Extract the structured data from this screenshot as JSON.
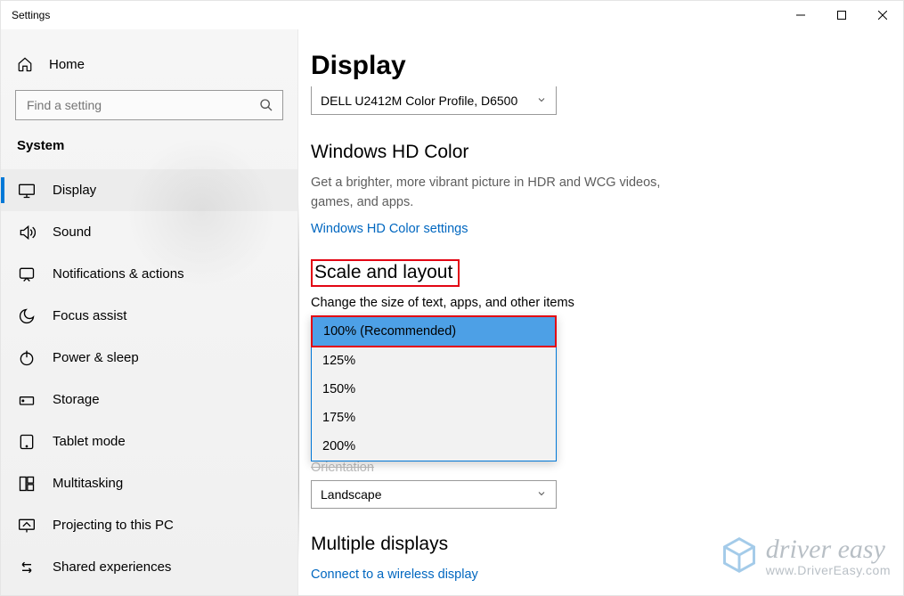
{
  "titlebar": {
    "title": "Settings"
  },
  "sidebar": {
    "home_label": "Home",
    "search_placeholder": "Find a setting",
    "category": "System",
    "items": [
      {
        "label": "Display"
      },
      {
        "label": "Sound"
      },
      {
        "label": "Notifications & actions"
      },
      {
        "label": "Focus assist"
      },
      {
        "label": "Power & sleep"
      },
      {
        "label": "Storage"
      },
      {
        "label": "Tablet mode"
      },
      {
        "label": "Multitasking"
      },
      {
        "label": "Projecting to this PC"
      },
      {
        "label": "Shared experiences"
      }
    ]
  },
  "main": {
    "page_title": "Display",
    "color_profile_selected": "DELL U2412M Color Profile, D6500",
    "hd_color": {
      "title": "Windows HD Color",
      "desc": "Get a brighter, more vibrant picture in HDR and WCG videos, games, and apps.",
      "link": "Windows HD Color settings"
    },
    "scale": {
      "title": "Scale and layout",
      "change_label": "Change the size of text, apps, and other items",
      "options": [
        "100% (Recommended)",
        "125%",
        "150%",
        "175%",
        "200%"
      ]
    },
    "orientation": {
      "hidden_label": "Orientation",
      "value": "Landscape"
    },
    "multiple_displays": {
      "title": "Multiple displays",
      "link": "Connect to a wireless display"
    }
  },
  "watermark": {
    "line1": "driver easy",
    "line2": "www.DriverEasy.com"
  }
}
